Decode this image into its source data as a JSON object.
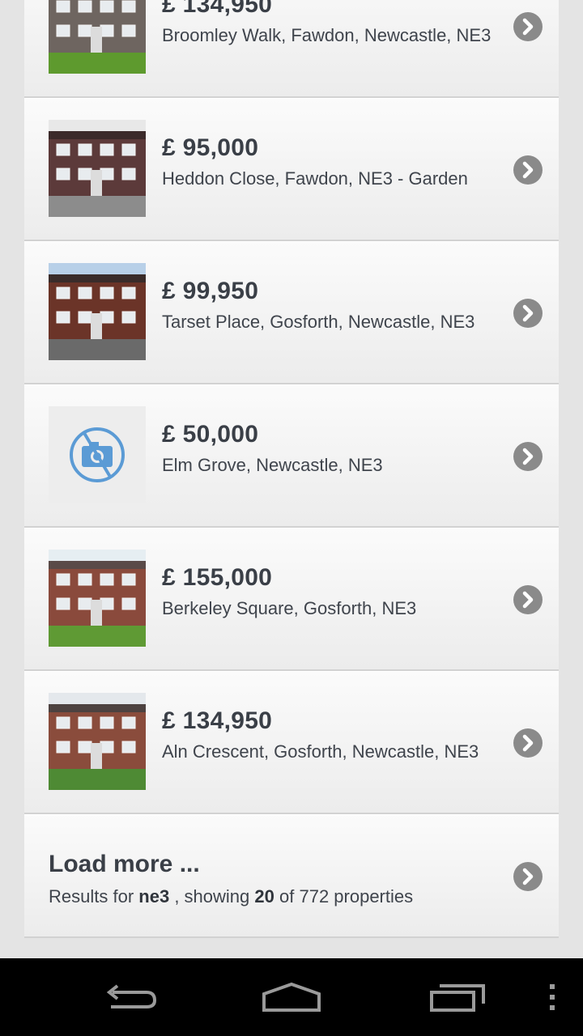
{
  "listings": [
    {
      "price": "£ 134,950",
      "address": "Broomley Walk, Fawdon, Newcastle, NE3",
      "photo": "house-photo",
      "colors": {
        "wall": "#6e6560",
        "roof": "#4a4a4a",
        "ground": "#5e9a2e",
        "sky": "#cfd8dc"
      }
    },
    {
      "price": "£ 95,000",
      "address": "Heddon Close, Fawdon, NE3 - Garden",
      "photo": "house-photo",
      "colors": {
        "wall": "#5c3a3a",
        "roof": "#3b2a2a",
        "ground": "#8c8c8c",
        "sky": "#e8e8e8"
      }
    },
    {
      "price": "£ 99,950",
      "address": "Tarset Place, Gosforth, Newcastle, NE3",
      "photo": "house-photo",
      "colors": {
        "wall": "#6b3428",
        "roof": "#3a2c2a",
        "ground": "#6a6a6a",
        "sky": "#b8d0e8"
      }
    },
    {
      "price": "£ 50,000",
      "address": "Elm Grove, Newcastle, NE3",
      "photo": "no-photo-icon",
      "colors": {
        "accent": "#5b9bd5",
        "bg": "#ededed"
      }
    },
    {
      "price": "£ 155,000",
      "address": "Berkeley Square, Gosforth, NE3",
      "photo": "house-photo",
      "colors": {
        "wall": "#8a4a3c",
        "roof": "#5a4a48",
        "ground": "#5f9a34",
        "sky": "#e6eef2"
      }
    },
    {
      "price": "£ 134,950",
      "address": "Aln Crescent, Gosforth, Newcastle, NE3",
      "photo": "house-photo",
      "colors": {
        "wall": "#8a4c3c",
        "roof": "#4d4240",
        "ground": "#4e8a34",
        "sky": "#e4e8ec"
      }
    }
  ],
  "load_more": {
    "title": "Load more ...",
    "prefix": "Results for",
    "query": "ne3",
    "middle": ", showing",
    "shown": "20",
    "suffix": "of 772 properties"
  },
  "navbar": {
    "back": "back-icon",
    "home": "home-icon",
    "recents": "recent-apps-icon",
    "menu": "overflow-menu-icon"
  }
}
